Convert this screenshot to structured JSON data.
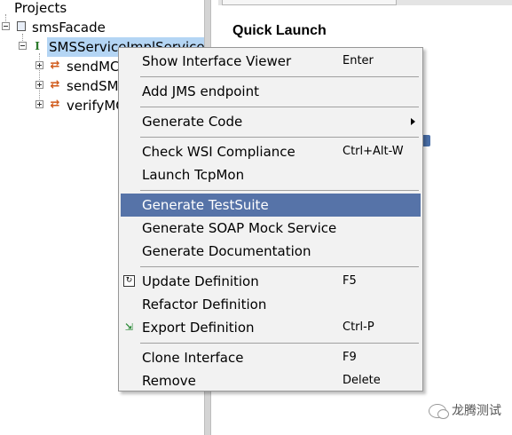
{
  "tree": {
    "root": {
      "label": "Projects"
    },
    "project": {
      "label": "smsFacade"
    },
    "interface": {
      "label": "SMSServiceImplService"
    },
    "operations": [
      {
        "label": "sendMC"
      },
      {
        "label": "sendSM"
      },
      {
        "label": "verifyMC"
      }
    ]
  },
  "right_panel": {
    "heading": "Quick Launch"
  },
  "context_menu": {
    "groups": [
      [
        {
          "label": "Show Interface Viewer",
          "shortcut": "Enter"
        }
      ],
      [
        {
          "label": "Add JMS endpoint",
          "shortcut": ""
        }
      ],
      [
        {
          "label": "Generate Code",
          "shortcut": "",
          "submenu": true
        }
      ],
      [
        {
          "label": "Check WSI Compliance",
          "shortcut": "Ctrl+Alt-W"
        },
        {
          "label": "Launch TcpMon",
          "shortcut": ""
        }
      ],
      [
        {
          "label": "Generate TestSuite",
          "shortcut": "",
          "highlighted": true
        },
        {
          "label": "Generate SOAP Mock Service",
          "shortcut": ""
        },
        {
          "label": "Generate Documentation",
          "shortcut": ""
        }
      ],
      [
        {
          "label": "Update Definition",
          "shortcut": "F5",
          "icon": "update-icon"
        },
        {
          "label": "Refactor Definition",
          "shortcut": ""
        },
        {
          "label": "Export Definition",
          "shortcut": "Ctrl-P",
          "icon": "export-icon"
        }
      ],
      [
        {
          "label": "Clone Interface",
          "shortcut": "F9"
        },
        {
          "label": "Remove",
          "shortcut": "Delete"
        }
      ]
    ]
  },
  "watermark": {
    "text": "龙腾测试"
  },
  "colors": {
    "menu_highlight": "#5673a8",
    "tree_selection": "#b4d5f4",
    "interface_icon": "#2c7a2c",
    "operation_icon": "#d05a1a"
  }
}
